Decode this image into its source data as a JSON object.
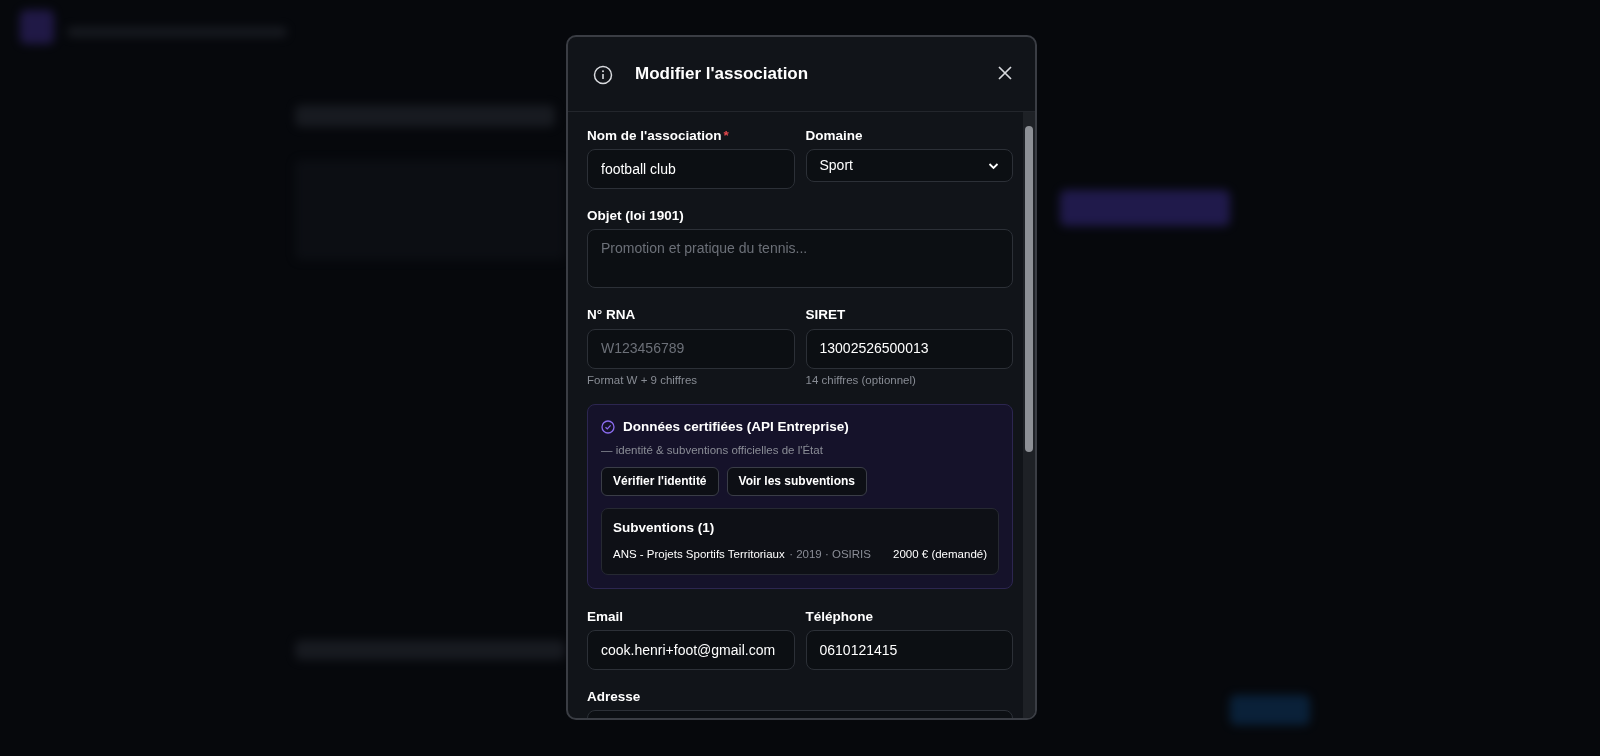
{
  "dialog": {
    "title": "Modifier l'association",
    "rows_before": [
      [
        {
          "kind": "text",
          "label": "Nom de l'association",
          "required_mark": "*",
          "value": "football club"
        },
        {
          "kind": "select",
          "label": "Domaine",
          "value": "Sport"
        }
      ],
      [
        {
          "kind": "textarea",
          "label": "Objet (loi 1901)",
          "placeholder": "Promotion et pratique du tennis..."
        }
      ],
      [
        {
          "kind": "text",
          "label": "N° RNA",
          "placeholder": "W123456789",
          "hint": "Format W + 9 chiffres"
        },
        {
          "kind": "text",
          "label": "SIRET",
          "value": "13002526500013",
          "hint": "14 chiffres (optionnel)"
        }
      ]
    ],
    "certified": {
      "title": "Données certifiées (API Entreprise)",
      "subtitle": "— identité & subventions officielles de l'État",
      "buttons": [
        "Vérifier l'identité",
        "Voir les subventions"
      ],
      "grants": {
        "title": "Subventions (1)",
        "items": [
          {
            "name": "ANS - Projets Sportifs Territoriaux",
            "meta": "· 2019 · OSIRIS",
            "amount": "2000 € (demandé)"
          }
        ]
      }
    },
    "rows_after": [
      [
        {
          "kind": "text",
          "label": "Email",
          "value": "cook.henri+foot@gmail.com"
        },
        {
          "kind": "text",
          "label": "Téléphone",
          "value": "0610121415"
        }
      ],
      [
        {
          "kind": "text",
          "label": "Adresse"
        }
      ]
    ]
  }
}
